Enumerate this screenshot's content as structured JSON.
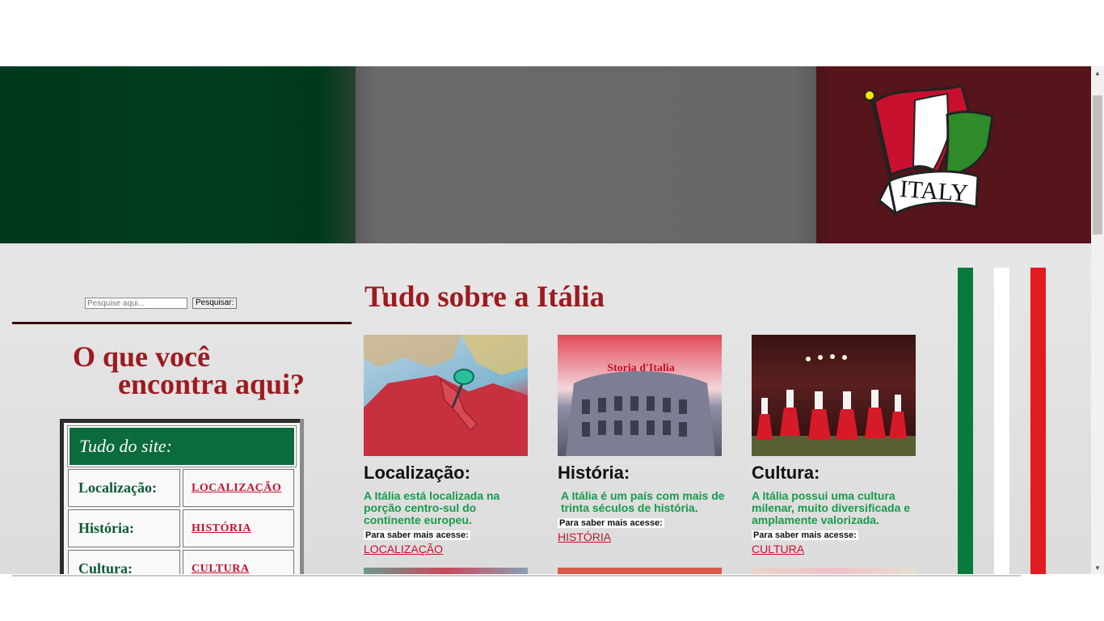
{
  "search": {
    "placeholder": "Pesquise aqui...",
    "button_label": "Pesquisar:"
  },
  "sidebar": {
    "heading_line1": "O que você",
    "heading_line2": "encontra aqui?",
    "box_title": "Tudo do site:",
    "rows": [
      {
        "label": "Localização:",
        "link": "LOCALIZAÇÃO"
      },
      {
        "label": "História:",
        "link": "HISTÓRIA"
      },
      {
        "label": "Cultura:",
        "link": "CULTURA"
      }
    ]
  },
  "banner": {
    "logo_text": "ITALY"
  },
  "main": {
    "title": "Tudo sobre a Itália",
    "more_label": "Para saber mais acesse:",
    "cards": [
      {
        "title": "Localização:",
        "desc": "A Itália está localizada na porção centro-sul do continente europeu.",
        "link": "LOCALIZAÇÃO",
        "image_caption": ""
      },
      {
        "title": "História:",
        "desc": "A Itália é um país com mais de trinta séculos de história.",
        "link": "HISTÓRIA",
        "image_caption": "Storia d'Italia"
      },
      {
        "title": "Cultura:",
        "desc": "A Itália possui uma cultura milenar, muito diversificada e amplamente valorizada.",
        "link": "CULTURA",
        "image_caption": ""
      }
    ]
  },
  "colors": {
    "italy_green": "#0b6b3c",
    "italy_red": "#c8102e",
    "title_red": "#9b1b1f"
  }
}
